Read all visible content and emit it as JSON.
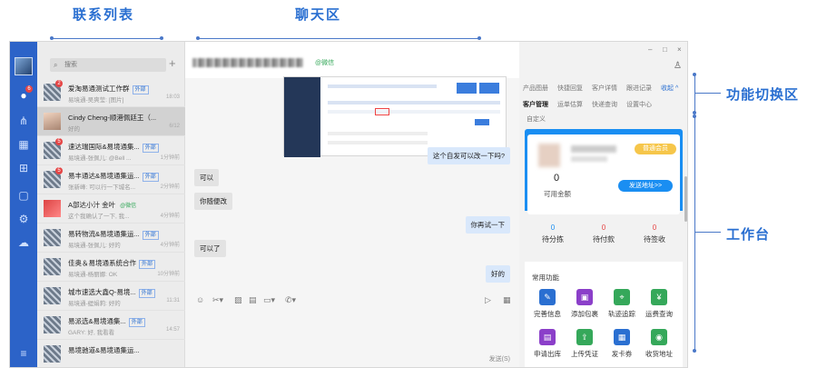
{
  "annotations": {
    "contact_list": "联系列表",
    "chat_area": "聊天区",
    "function_switch": "功能切换区",
    "workbench": "工作台"
  },
  "nav": {
    "badge": "6",
    "icons": [
      "avatar",
      "chat-icon",
      "org-chart-icon",
      "calendar-icon",
      "apps-icon",
      "mail-icon",
      "gear-icon",
      "cloud-icon",
      "menu-icon"
    ]
  },
  "contact_list": {
    "search_placeholder": "搜索",
    "items": [
      {
        "name": "爱淘易通测试工作群",
        "tag": "外部",
        "preview": "易境通-吴爽莹: [图片]",
        "time": "18:03",
        "badge": "2",
        "avatar": "group"
      },
      {
        "name": "Cindy Cheng-顺港佩廷王（...",
        "tag": "",
        "preview": "好的",
        "time": "6/12",
        "badge": "",
        "avatar": "photo"
      },
      {
        "name": "速达瑞国际&易境通集...",
        "tag": "外部",
        "preview": "易境通-张佩儿: @Bell ...",
        "time": "1分钟前",
        "badge": "5",
        "avatar": "group"
      },
      {
        "name": "易丰通达&易境通集运...",
        "tag": "外部",
        "preview": "张新峰: 可以行一下城名...",
        "time": "2分钟前",
        "badge": "5",
        "avatar": "group"
      },
      {
        "name": "A部达小汁 金叶",
        "tag": "@微信",
        "tag_green": true,
        "preview": "这个我确认了一下, 我...",
        "time": "4分钟前",
        "badge": "",
        "avatar": "red"
      },
      {
        "name": "易转物流&易境通集运...",
        "tag": "外部",
        "preview": "易境通-张佩儿: 好的",
        "time": "4分钟前",
        "badge": "",
        "avatar": "group"
      },
      {
        "name": "佳奥＆易境通系统合作",
        "tag": "外部",
        "preview": "易境通-杨丽娜: OK",
        "time": "10分钟前",
        "badge": "",
        "avatar": "group"
      },
      {
        "name": "城市速选大鑫Q-易境...",
        "tag": "外部",
        "preview": "易境通-缇娟莉: 好的",
        "time": "11:31",
        "badge": "",
        "avatar": "group"
      },
      {
        "name": "易派选&易境通集...",
        "tag": "外部",
        "preview": "GARY: 好, 我看看",
        "time": "14:57",
        "badge": "",
        "avatar": "group"
      },
      {
        "name": "易境驰道&易境通集运...",
        "tag": "",
        "preview": "",
        "time": "",
        "badge": "",
        "avatar": "group"
      }
    ]
  },
  "chat": {
    "title_tag": "@微信",
    "messages": [
      {
        "side": "right",
        "text": "这个自发可以改一下吗?"
      },
      {
        "side": "left",
        "text": "可以"
      },
      {
        "side": "left",
        "text": "你随便改"
      },
      {
        "side": "right",
        "text": "你再试一下"
      },
      {
        "side": "left",
        "text": "可以了"
      },
      {
        "side": "right",
        "text": "好的"
      }
    ],
    "send_label": "发送(S)"
  },
  "right": {
    "tabs_row1": [
      "产品图册",
      "快捷回复",
      "客户详情",
      "跟进记录",
      "收起 ^"
    ],
    "tabs_row2": [
      "客户管理",
      "运单估算",
      "快递查询",
      "设置中心"
    ],
    "tabs_row3": [
      "自定义"
    ],
    "member_badge": "普通会员",
    "amount": "0",
    "amount_label": "可用金额",
    "send_address": "发送地址>>",
    "stats": [
      {
        "num": "0",
        "label": "待分拣",
        "color": "#1a8ef2"
      },
      {
        "num": "0",
        "label": "待付款",
        "color": "#e54545"
      },
      {
        "num": "0",
        "label": "待签收",
        "color": "#e54545"
      }
    ],
    "common_title": "常用功能",
    "functions": [
      {
        "label": "完善信息",
        "icon": "edit-icon",
        "color": "#2a6fd1",
        "glyph": "✎"
      },
      {
        "label": "添加包裹",
        "icon": "package-icon",
        "color": "#8b3fc9",
        "glyph": "▣"
      },
      {
        "label": "轨迹追踪",
        "icon": "track-icon",
        "color": "#35a85a",
        "glyph": "⌖"
      },
      {
        "label": "运费查询",
        "icon": "fee-icon",
        "color": "#35a85a",
        "glyph": "¥"
      },
      {
        "label": "申请出库",
        "icon": "outbound-icon",
        "color": "#8b3fc9",
        "glyph": "▤"
      },
      {
        "label": "上传凭证",
        "icon": "upload-icon",
        "color": "#35a85a",
        "glyph": "⇪"
      },
      {
        "label": "发卡券",
        "icon": "coupon-icon",
        "color": "#2a6fd1",
        "glyph": "▦"
      },
      {
        "label": "收货地址",
        "icon": "location-icon",
        "color": "#35a85a",
        "glyph": "◉"
      }
    ]
  }
}
